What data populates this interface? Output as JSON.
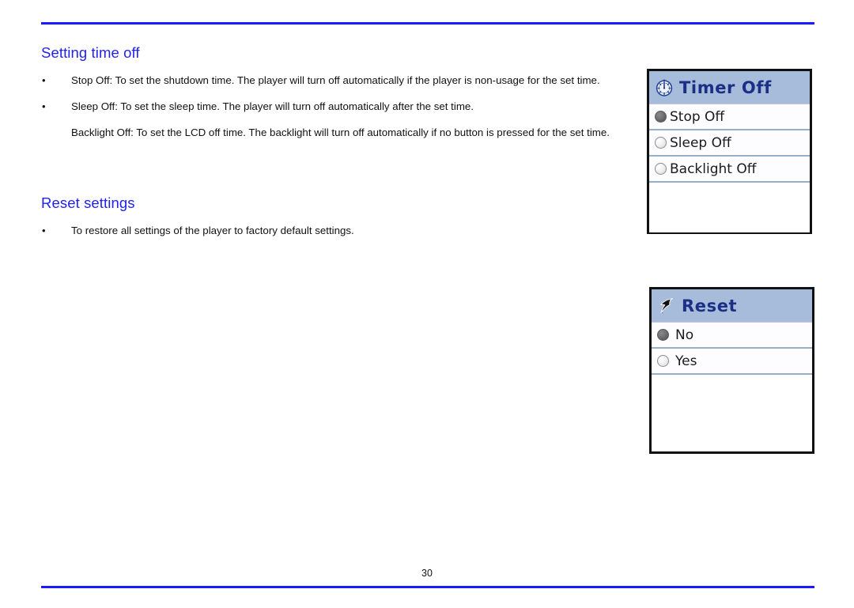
{
  "page": {
    "number": "30"
  },
  "sections": [
    {
      "heading": "Setting time off",
      "bullets": [
        {
          "text": "Stop Off: To set the shutdown time. The player will turn off automatically if the player is non-usage for the set time."
        },
        {
          "text": "Sleep Off: To set the sleep time. The player will turn off automatically after the set time.",
          "sub": "Backlight Off: To set the LCD off time. The backlight will turn off automatically if no button is pressed for the set time."
        }
      ]
    },
    {
      "heading": "Reset settings",
      "bullets": [
        {
          "text": "To restore all settings of the player to factory default settings."
        }
      ]
    }
  ],
  "devices": {
    "timer": {
      "title": "Timer Off",
      "icon": "timer-clock-icon",
      "rows": [
        {
          "label": "Stop Off",
          "selected": true
        },
        {
          "label": "Sleep Off",
          "selected": false
        },
        {
          "label": "Backlight Off",
          "selected": false
        }
      ]
    },
    "reset": {
      "title": "Reset",
      "icon": "cursor-arrow-icon",
      "rows": [
        {
          "label": "No",
          "selected": true
        },
        {
          "label": "Yes",
          "selected": false
        }
      ]
    }
  },
  "colors": {
    "heading_blue": "#2222ee",
    "rule_blue": "#1a1aff",
    "device_header_bg": "#a7bbdb",
    "device_title_blue": "#1b2f86",
    "row_divider": "#97b0c9"
  }
}
